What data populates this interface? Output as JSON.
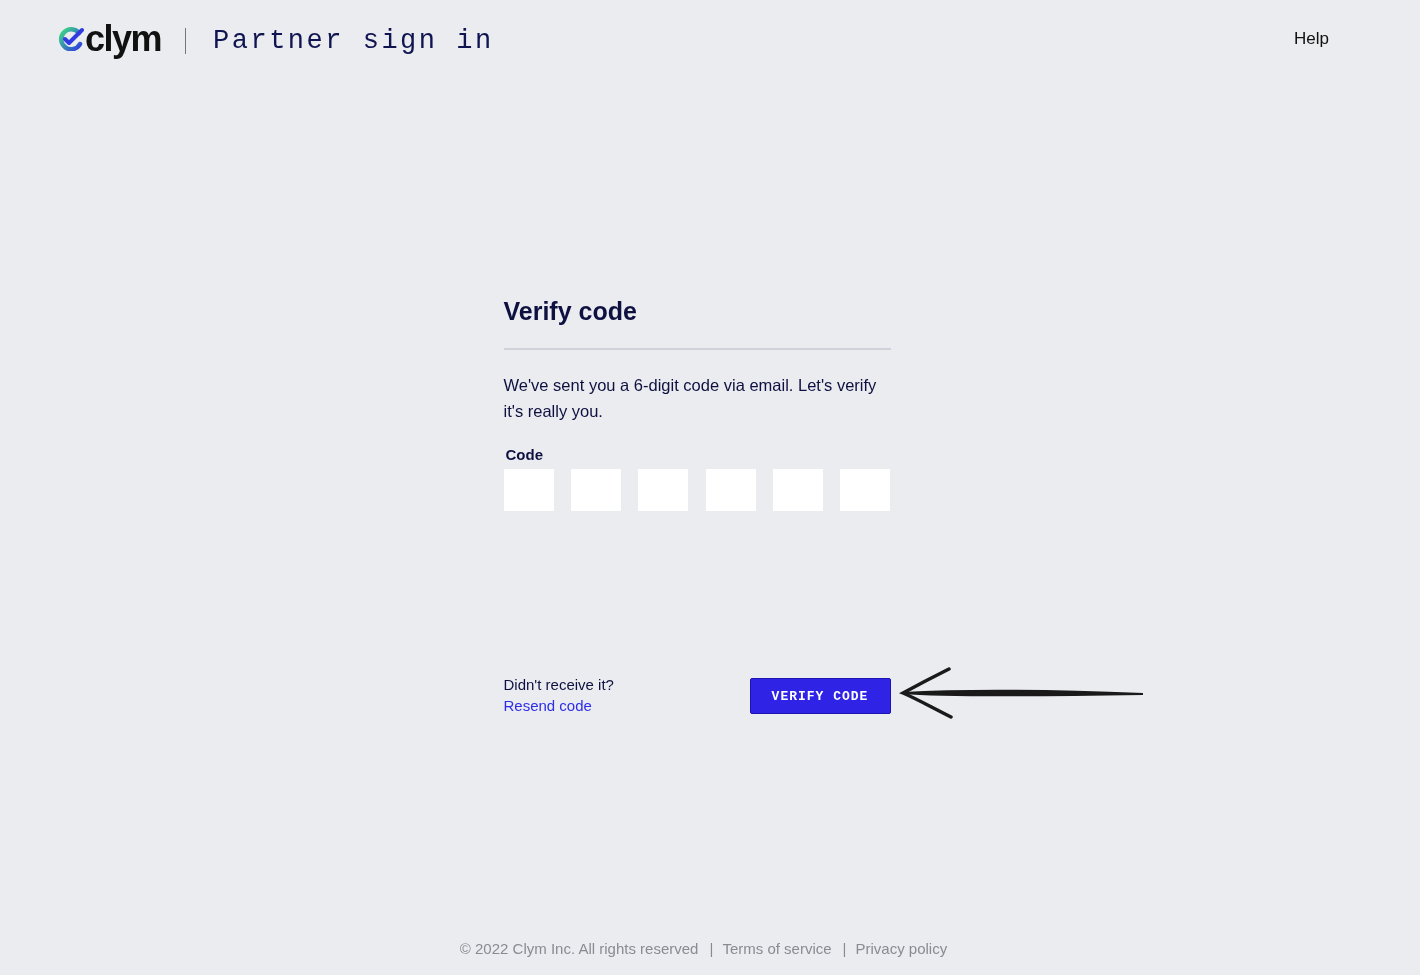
{
  "header": {
    "logo": "clym",
    "title": "Partner sign in",
    "help": "Help"
  },
  "card": {
    "title": "Verify code",
    "message": "We've sent you a 6-digit code via email. Let's verify it's really you.",
    "code": {
      "label": "Code",
      "fields": [
        {
          "kind": "digit"
        },
        {
          "kind": "digit"
        },
        {
          "kind": "digit"
        },
        {
          "kind": "digit"
        },
        {
          "kind": "digit"
        },
        {
          "kind": "digit"
        }
      ]
    },
    "resend_prompt": "Didn't receive it?",
    "resend_link": "Resend code",
    "button": "VERIFY CODE"
  },
  "footer": {
    "copyright": "© 2022 Clym Inc. All rights reserved",
    "separators": [
      "|",
      "|"
    ],
    "links": [
      "Terms of service",
      "Privacy policy"
    ]
  }
}
